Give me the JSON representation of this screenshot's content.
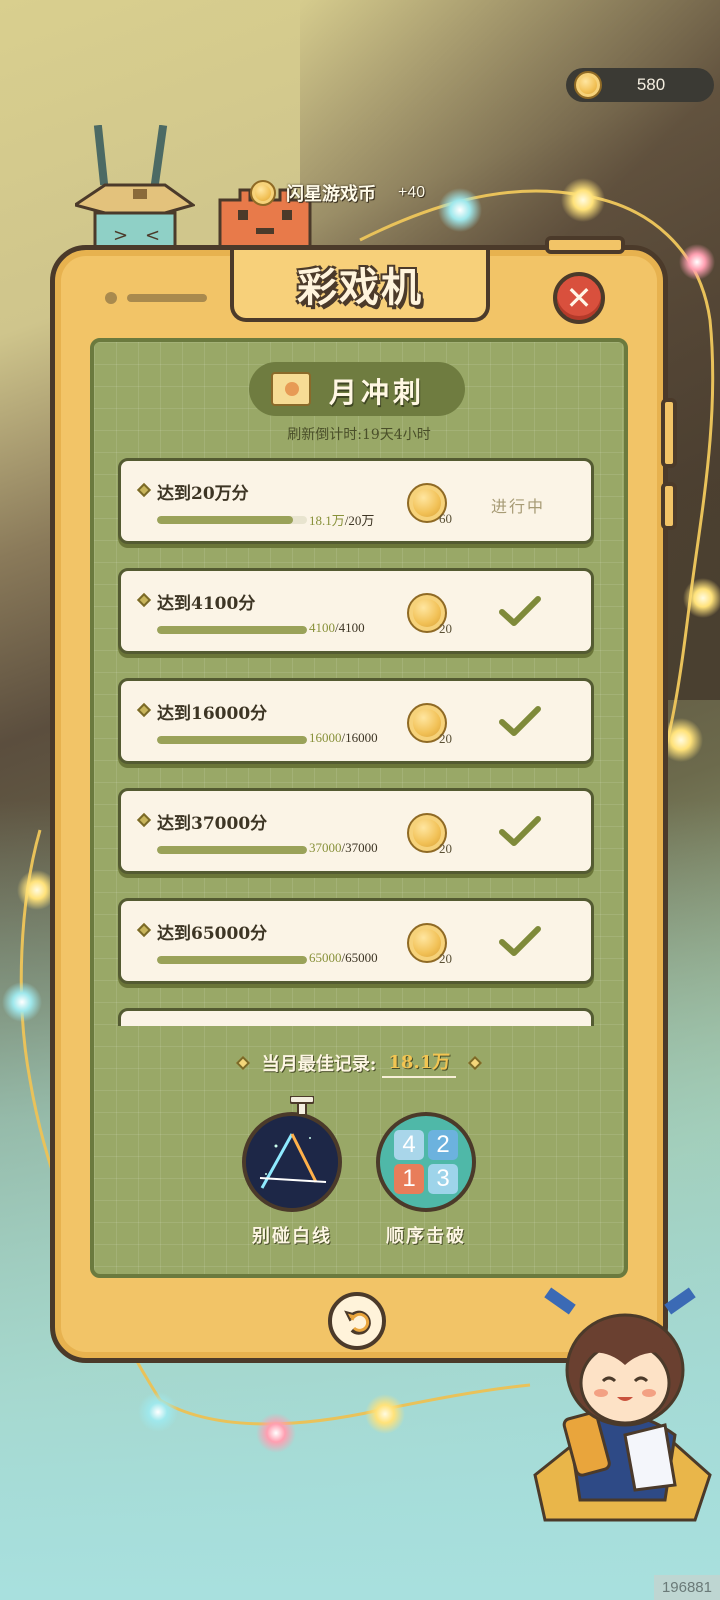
{
  "currency": {
    "balance": "580",
    "icon": "coin-icon"
  },
  "reward_popup": {
    "label": "闪星游戏币",
    "amount": "+40"
  },
  "panel": {
    "title": "彩戏机",
    "close_icon": "close-icon",
    "section_title": "月冲刺",
    "refresh_text": "刷新倒计时:19天4小时",
    "tasks": [
      {
        "goal": "达到20万分",
        "current": "18.1万",
        "total": "/20万",
        "progress": 0.905,
        "reward": "60",
        "status": "进行中",
        "done": false
      },
      {
        "goal": "达到4100分",
        "current": "4100",
        "total": "/4100",
        "progress": 1,
        "reward": "20",
        "status": "",
        "done": true
      },
      {
        "goal": "达到16000分",
        "current": "16000",
        "total": "/16000",
        "progress": 1,
        "reward": "20",
        "status": "",
        "done": true
      },
      {
        "goal": "达到37000分",
        "current": "37000",
        "total": "/37000",
        "progress": 1,
        "reward": "20",
        "status": "",
        "done": true
      },
      {
        "goal": "达到65000分",
        "current": "65000",
        "total": "/65000",
        "progress": 1,
        "reward": "20",
        "status": "",
        "done": true
      }
    ],
    "best_label": "当月最佳记录:",
    "best_value": "18.1万",
    "games": [
      {
        "name": "别碰白线",
        "icon": "stopwatch-lines-icon"
      },
      {
        "name": "顺序击破",
        "icon": "number-grid-icon",
        "tiles": [
          "4",
          "2",
          "1",
          "3"
        ]
      }
    ],
    "back_icon": "back-arrow-icon"
  },
  "watermark": "196881",
  "colors": {
    "board": "#99a867",
    "frame": "#f2c467",
    "outline": "#4b3a2a",
    "progress_fill": "#9aa259",
    "close": "#d9503d",
    "best_value": "#f3c552"
  }
}
